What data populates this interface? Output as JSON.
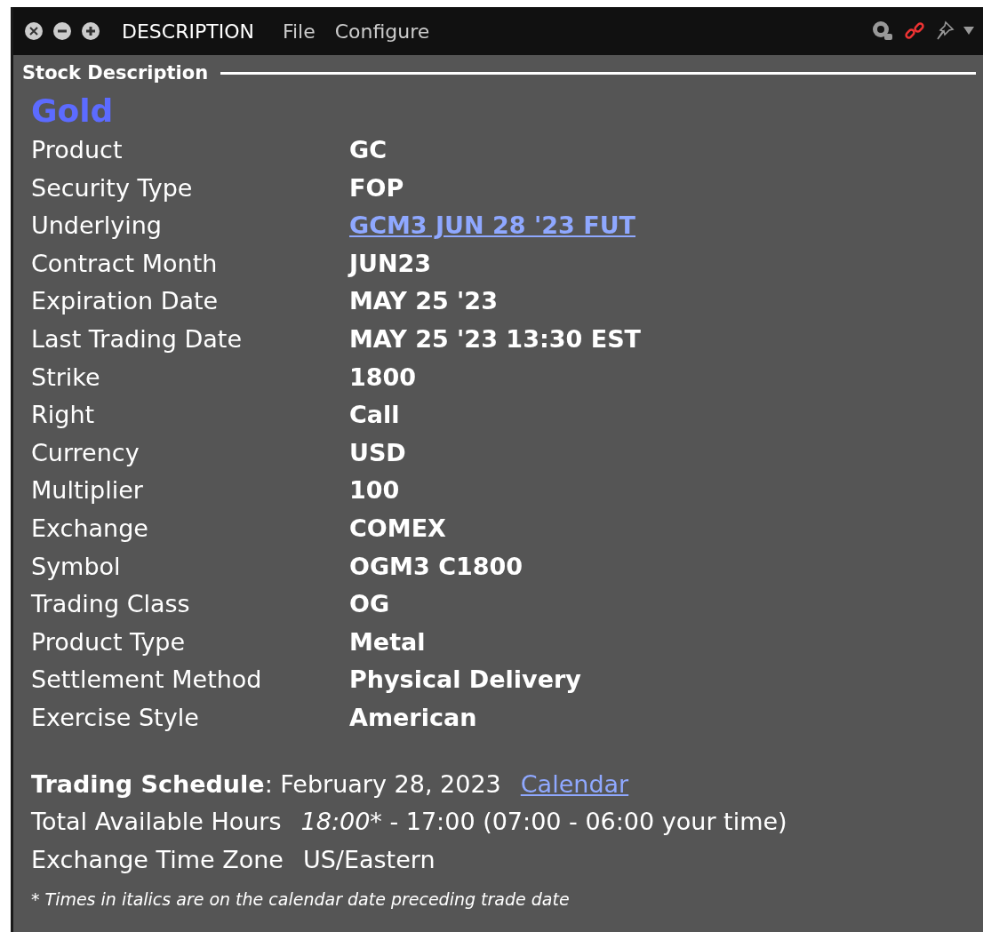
{
  "window": {
    "title": "DESCRIPTION",
    "menus": [
      "File",
      "Configure"
    ]
  },
  "section": {
    "title": "Stock Description"
  },
  "name": "Gold",
  "rows": [
    {
      "label": "Product",
      "value": "GC",
      "kind": "text"
    },
    {
      "label": "Security Type",
      "value": "FOP",
      "kind": "text"
    },
    {
      "label": "Underlying",
      "value": "GCM3 JUN 28 '23 FUT",
      "kind": "link"
    },
    {
      "label": "Contract Month",
      "value": "JUN23",
      "kind": "text"
    },
    {
      "label": "Expiration Date",
      "value": "MAY 25 '23",
      "kind": "text"
    },
    {
      "label": "Last Trading Date",
      "value": "MAY 25 '23 13:30 EST",
      "kind": "text"
    },
    {
      "label": "Strike",
      "value": "1800",
      "kind": "text"
    },
    {
      "label": "Right",
      "value": "Call",
      "kind": "text"
    },
    {
      "label": "Currency",
      "value": "USD",
      "kind": "text"
    },
    {
      "label": "Multiplier",
      "value": "100",
      "kind": "text"
    },
    {
      "label": "Exchange",
      "value": "COMEX",
      "kind": "text"
    },
    {
      "label": "Symbol",
      "value": "OGM3 C1800",
      "kind": "text"
    },
    {
      "label": "Trading Class",
      "value": "OG",
      "kind": "text"
    },
    {
      "label": "Product Type",
      "value": "Metal",
      "kind": "text"
    },
    {
      "label": "Settlement Method",
      "value": "Physical Delivery",
      "kind": "text"
    },
    {
      "label": "Exercise Style",
      "value": "American",
      "kind": "text"
    }
  ],
  "schedule": {
    "heading": "**Trading Schedule**: February 28, 2023",
    "link": "Calendar",
    "hours_label": "Total Available Hours",
    "hours_italic": "18:00",
    "hours_rest": "* - 17:00 (07:00 - 06:00 your time)",
    "zone_label": "Exchange Time Zone",
    "zone_value": "US/Eastern",
    "note": "* Times in italics are on the calendar date preceding trade date"
  }
}
